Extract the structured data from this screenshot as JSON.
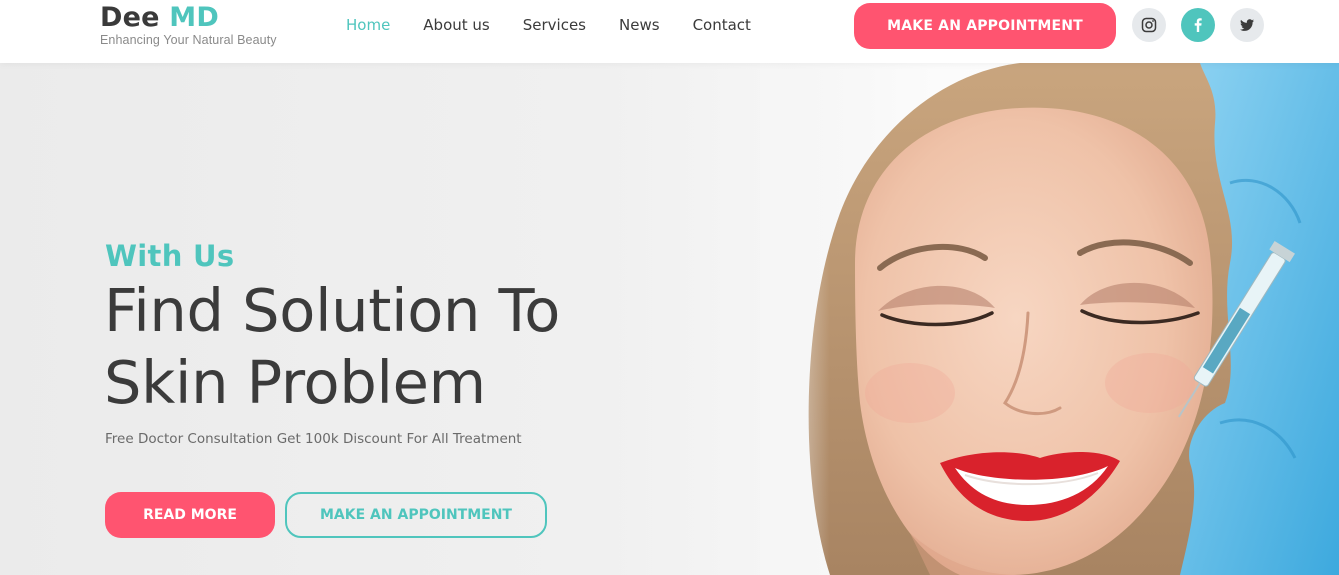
{
  "brand": {
    "name_part1": "Dee",
    "name_part2": "MD",
    "tagline": "Enhancing Your Natural Beauty"
  },
  "nav": {
    "items": [
      {
        "label": "Home",
        "active": true
      },
      {
        "label": "About us",
        "active": false
      },
      {
        "label": "Services",
        "active": false
      },
      {
        "label": "News",
        "active": false
      },
      {
        "label": "Contact",
        "active": false
      }
    ]
  },
  "header": {
    "appointment_label": "MAKE AN APPOINTMENT",
    "social": [
      {
        "icon": "instagram-icon"
      },
      {
        "icon": "facebook-icon"
      },
      {
        "icon": "twitter-icon"
      }
    ]
  },
  "hero": {
    "kicker": "With Us",
    "headline_line1": "Find Solution To",
    "headline_line2": "Skin Problem",
    "subtext": "Free Doctor Consultation Get 100k Discount For All Treatment",
    "read_more_label": "READ MORE",
    "appointment_label": "MAKE AN APPOINTMENT"
  },
  "colors": {
    "accent": "#4fc5bd",
    "primary": "#ff5470",
    "text": "#3b3b3b"
  }
}
